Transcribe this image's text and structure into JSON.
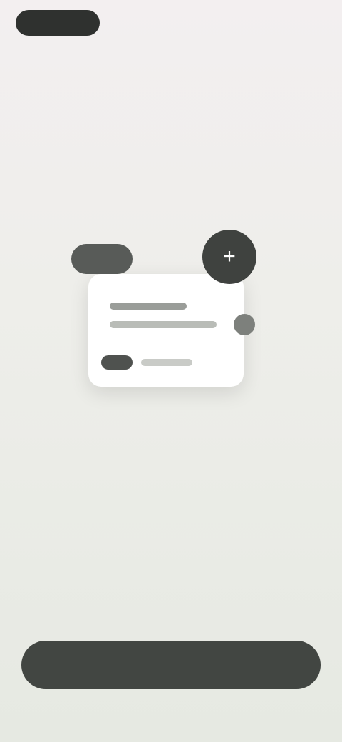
{
  "top_bar": {
    "left_button_label": "",
    "right_link_label": ""
  },
  "hero": {
    "circle_icon_glyph": "+"
  },
  "description": {
    "line_1": "",
    "line_2": "",
    "line_3": ""
  },
  "primary_action": {
    "label": ""
  },
  "colors": {
    "primary_button": "#424642",
    "top_pill": "#2f312f",
    "background_top": "#f3eff0",
    "background_bottom": "#e6e9e2"
  },
  "icons": {
    "hero_circle": "plus-icon"
  }
}
